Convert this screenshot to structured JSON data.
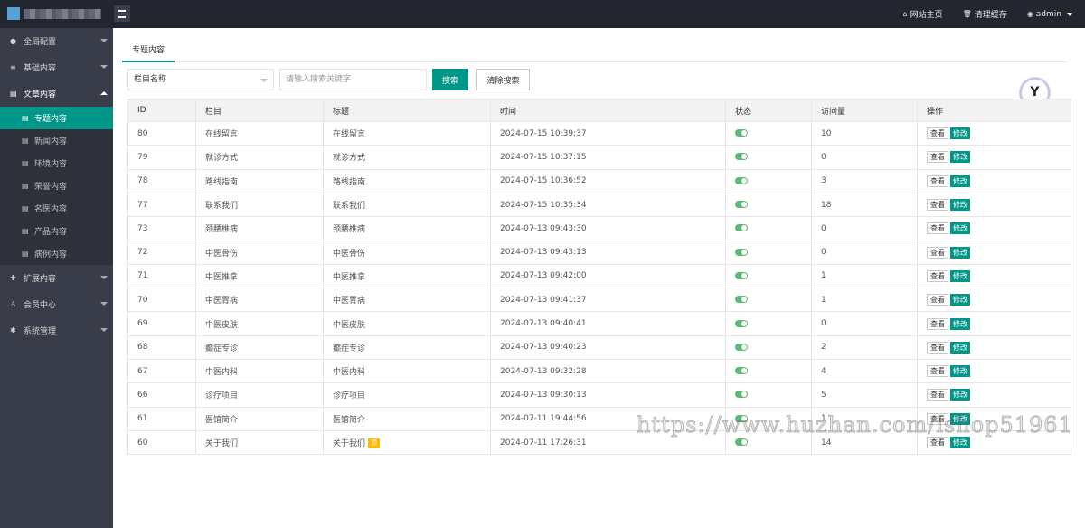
{
  "header": {
    "links": [
      {
        "icon": "home-icon",
        "glyph": "⌂",
        "label": "网站主页"
      },
      {
        "icon": "trash-icon",
        "glyph": "🗑",
        "label": "清理缓存"
      },
      {
        "icon": "user-icon",
        "glyph": "◉",
        "label": "admin"
      }
    ]
  },
  "sidebar": {
    "groups": [
      {
        "glyph": "●",
        "label": "全局配置"
      },
      {
        "glyph": "≡",
        "label": "基础内容"
      },
      {
        "glyph": "▤",
        "label": "文章内容"
      }
    ],
    "sub_items": [
      {
        "label": "专题内容"
      },
      {
        "label": "新闻内容"
      },
      {
        "label": "环境内容"
      },
      {
        "label": "荣誉内容"
      },
      {
        "label": "名医内容"
      },
      {
        "label": "产品内容"
      },
      {
        "label": "病例内容"
      }
    ],
    "groups_after": [
      {
        "glyph": "✚",
        "label": "扩展内容"
      },
      {
        "glyph": "♙",
        "label": "会员中心"
      },
      {
        "glyph": "✱",
        "label": "系统管理"
      }
    ]
  },
  "tabs": [
    {
      "label": "专题内容"
    }
  ],
  "filter": {
    "select_value": "栏目名称",
    "search_placeholder": "请输入搜索关键字",
    "search_label": "搜索",
    "clear_label": "清除搜索"
  },
  "table": {
    "columns": [
      "ID",
      "栏目",
      "标题",
      "时间",
      "状态",
      "访问量",
      "操作"
    ],
    "view_label": "查看",
    "edit_label": "修改",
    "rows": [
      {
        "id": "80",
        "column": "在线留言",
        "title": "在线留言",
        "time": "2024-07-15 10:39:37",
        "status": true,
        "visits": "10"
      },
      {
        "id": "79",
        "column": "就诊方式",
        "title": "就诊方式",
        "time": "2024-07-15 10:37:15",
        "status": true,
        "visits": "0"
      },
      {
        "id": "78",
        "column": "路线指南",
        "title": "路线指南",
        "time": "2024-07-15 10:36:52",
        "status": true,
        "visits": "3"
      },
      {
        "id": "77",
        "column": "联系我们",
        "title": "联系我们",
        "time": "2024-07-15 10:35:34",
        "status": true,
        "visits": "18"
      },
      {
        "id": "73",
        "column": "颈腰椎病",
        "title": "颈腰椎病",
        "time": "2024-07-13 09:43:30",
        "status": true,
        "visits": "0"
      },
      {
        "id": "72",
        "column": "中医骨伤",
        "title": "中医骨伤",
        "time": "2024-07-13 09:43:13",
        "status": true,
        "visits": "0"
      },
      {
        "id": "71",
        "column": "中医推拿",
        "title": "中医推拿",
        "time": "2024-07-13 09:42:00",
        "status": true,
        "visits": "1"
      },
      {
        "id": "70",
        "column": "中医胃病",
        "title": "中医胃病",
        "time": "2024-07-13 09:41:37",
        "status": true,
        "visits": "1"
      },
      {
        "id": "69",
        "column": "中医皮肤",
        "title": "中医皮肤",
        "time": "2024-07-13 09:40:41",
        "status": true,
        "visits": "0"
      },
      {
        "id": "68",
        "column": "癫症专诊",
        "title": "癫症专诊",
        "time": "2024-07-13 09:40:23",
        "status": true,
        "visits": "2"
      },
      {
        "id": "67",
        "column": "中医内科",
        "title": "中医内科",
        "time": "2024-07-13 09:32:28",
        "status": true,
        "visits": "4"
      },
      {
        "id": "66",
        "column": "诊疗项目",
        "title": "诊疗项目",
        "time": "2024-07-13 09:30:13",
        "status": true,
        "visits": "5"
      },
      {
        "id": "61",
        "column": "医馆简介",
        "title": "医馆简介",
        "time": "2024-07-11 19:44:56",
        "status": true,
        "visits": "1"
      },
      {
        "id": "60",
        "column": "关于我们",
        "title": "关于我们",
        "tag": "顶",
        "time": "2024-07-11 17:26:31",
        "status": true,
        "visits": "14"
      }
    ]
  },
  "watermark": "https://www.huzhan.com/ishop51961"
}
